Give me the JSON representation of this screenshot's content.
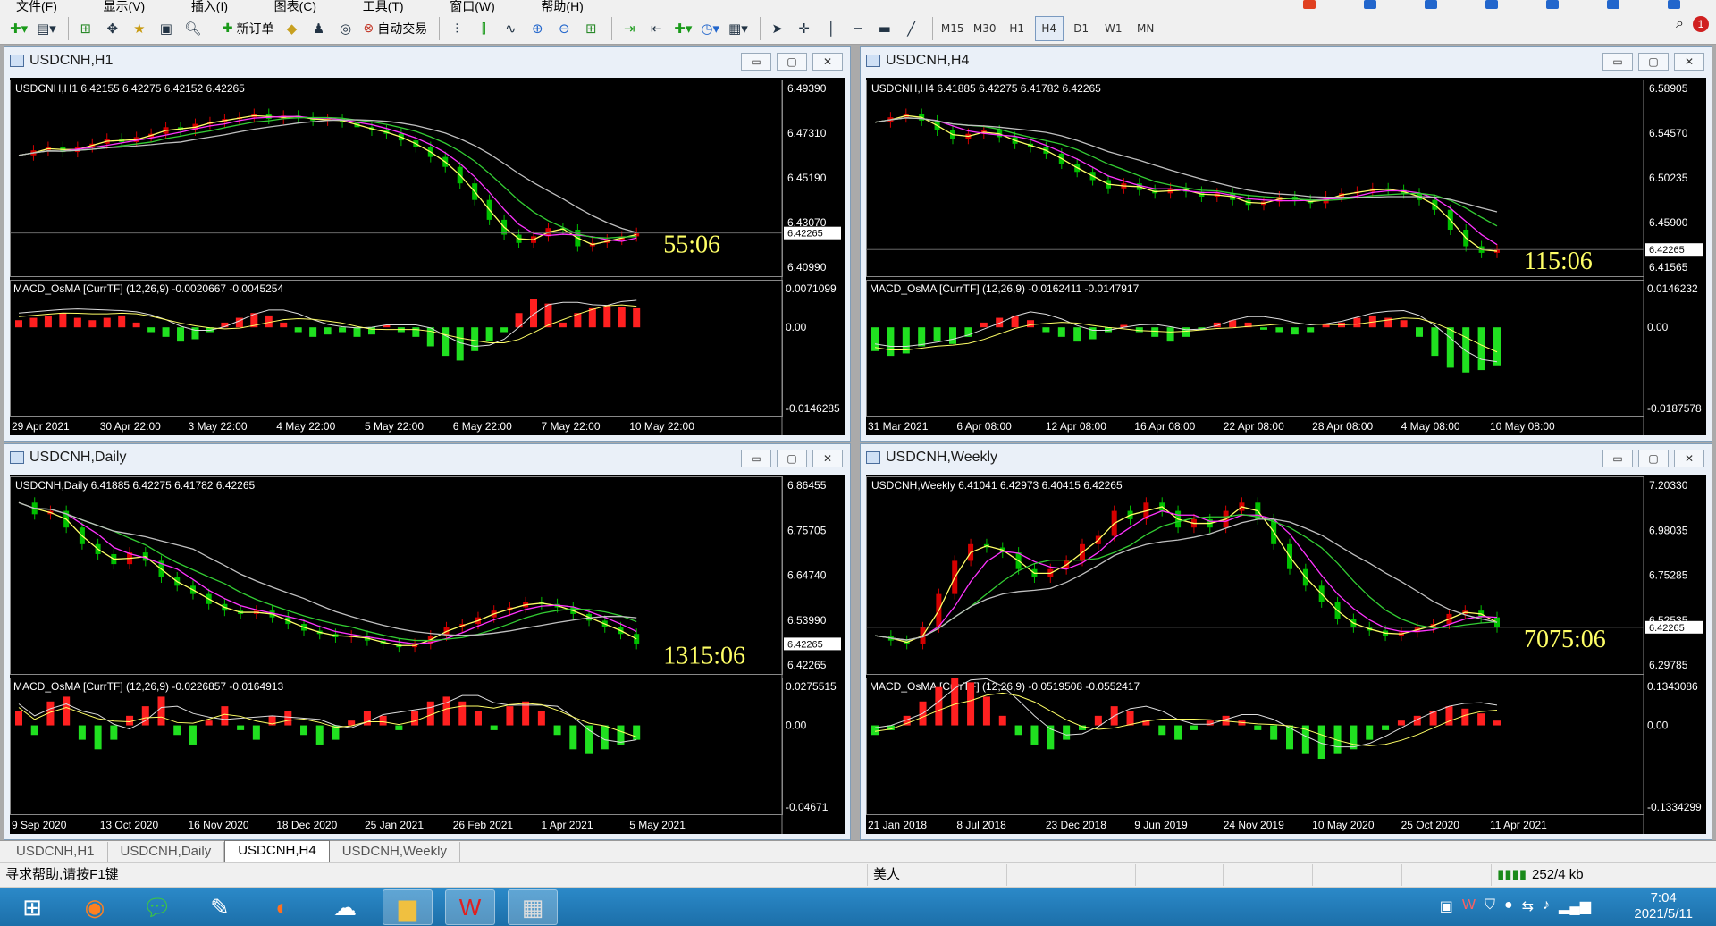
{
  "menu": [
    "文件(F)",
    "显示(V)",
    "插入(I)",
    "图表(C)",
    "工具(T)",
    "窗口(W)",
    "帮助(H)"
  ],
  "toolbar": {
    "new_order": "新订单",
    "auto_trade": "自动交易",
    "timeframes": [
      "M15",
      "M30",
      "H1",
      "H4",
      "D1",
      "W1",
      "MN"
    ],
    "active_timeframe": "H4"
  },
  "colors": {
    "up": "#d40000",
    "down": "#00c000",
    "ma_yellow": "#ffff66",
    "ma_magenta": "#ff33ff",
    "ma_green": "#33cc33",
    "ma_gray": "#c0c0c0",
    "countdown": "#ffff66",
    "hist_up": "#ff2020",
    "hist_down": "#20e020"
  },
  "windows": [
    {
      "title": "USDCNH,H1",
      "info": "USDCNH,H1  6.42155 6.42275 6.42152 6.42265",
      "price_labels": [
        "6.49390",
        "6.47310",
        "6.45190",
        "6.43070",
        "6.40990"
      ],
      "current_price": "6.42265",
      "countdown": "55:06",
      "macd_info": "MACD_OsMA [CurrTF] (12,26,9) -0.0020667 -0.0045254",
      "macd_labels": [
        "0.0071099",
        "0.00",
        "-0.0146285"
      ],
      "dates": [
        "29 Apr 2021",
        "30 Apr 22:00",
        "3 May 22:00",
        "4 May 22:00",
        "5 May 22:00",
        "6 May 22:00",
        "7 May 22:00",
        "10 May 22:00"
      ],
      "price_path": [
        0.35,
        0.32,
        0.3,
        0.33,
        0.3,
        0.28,
        0.25,
        0.27,
        0.24,
        0.22,
        0.18,
        0.2,
        0.16,
        0.15,
        0.13,
        0.12,
        0.1,
        0.13,
        0.11,
        0.12,
        0.14,
        0.13,
        0.15,
        0.18,
        0.2,
        0.22,
        0.26,
        0.3,
        0.36,
        0.42,
        0.52,
        0.62,
        0.74,
        0.83,
        0.88,
        0.84,
        0.79,
        0.8,
        0.9,
        0.88,
        0.86,
        0.84,
        0.82
      ],
      "hist": [
        0.15,
        0.2,
        0.25,
        0.3,
        0.2,
        0.15,
        0.2,
        0.25,
        0.1,
        -0.1,
        -0.2,
        -0.3,
        -0.25,
        -0.1,
        0.1,
        0.2,
        0.3,
        0.25,
        0.1,
        -0.1,
        -0.2,
        -0.15,
        -0.1,
        -0.2,
        -0.15,
        0.05,
        -0.1,
        -0.2,
        -0.4,
        -0.6,
        -0.7,
        -0.5,
        -0.3,
        -0.1,
        0.3,
        0.6,
        0.5,
        0.1,
        0.3,
        0.4,
        0.45,
        0.42,
        0.4
      ]
    },
    {
      "title": "USDCNH,H4",
      "info": "USDCNH,H4  6.41885 6.42275 6.41782 6.42265",
      "price_labels": [
        "6.58905",
        "6.54570",
        "6.50235",
        "6.45900",
        "6.41565"
      ],
      "current_price": "6.42265",
      "countdown": "115:06",
      "macd_info": "MACD_OsMA [CurrTF] (12,26,9) -0.0162411 -0.0147917",
      "macd_labels": [
        "0.0146232",
        "0.00",
        "-0.0187578"
      ],
      "dates": [
        "31 Mar 2021",
        "6 Apr 08:00",
        "12 Apr 08:00",
        "16 Apr 08:00",
        "22 Apr 08:00",
        "28 Apr 08:00",
        "4 May 08:00",
        "10 May 08:00"
      ],
      "price_path": [
        0.15,
        0.12,
        0.1,
        0.14,
        0.2,
        0.25,
        0.22,
        0.2,
        0.24,
        0.28,
        0.3,
        0.34,
        0.4,
        0.45,
        0.5,
        0.55,
        0.52,
        0.56,
        0.58,
        0.55,
        0.57,
        0.6,
        0.58,
        0.62,
        0.65,
        0.63,
        0.6,
        0.62,
        0.64,
        0.6,
        0.58,
        0.57,
        0.55,
        0.56,
        0.58,
        0.62,
        0.68,
        0.8,
        0.9,
        0.94,
        0.92
      ],
      "hist": [
        -0.5,
        -0.6,
        -0.55,
        -0.4,
        -0.3,
        -0.35,
        -0.2,
        0.1,
        0.2,
        0.25,
        0.15,
        -0.1,
        -0.2,
        -0.3,
        -0.25,
        -0.1,
        0.05,
        -0.1,
        -0.2,
        -0.3,
        -0.2,
        -0.05,
        0.1,
        0.15,
        0.1,
        -0.05,
        -0.1,
        -0.15,
        -0.1,
        0.05,
        0.1,
        0.2,
        0.25,
        0.2,
        0.15,
        -0.2,
        -0.6,
        -0.85,
        -0.95,
        -0.9,
        -0.8
      ]
    },
    {
      "title": "USDCNH,Daily",
      "info": "USDCNH,Daily  6.41885 6.42275 6.41782 6.42265",
      "price_labels": [
        "6.86455",
        "6.75705",
        "6.64740",
        "6.53990",
        "6.42265"
      ],
      "current_price": "6.42265",
      "countdown": "1315:06",
      "macd_info": "MACD_OsMA [CurrTF] (12,26,9) -0.0226857 -0.0164913",
      "macd_labels": [
        "0.0275515",
        "0.00",
        "-0.04671"
      ],
      "dates": [
        "9 Sep 2020",
        "13 Oct 2020",
        "16 Nov 2020",
        "18 Dec 2020",
        "25 Jan 2021",
        "26 Feb 2021",
        "1 Apr 2021",
        "5 May 2021"
      ],
      "price_path": [
        0.05,
        0.12,
        0.1,
        0.2,
        0.3,
        0.36,
        0.42,
        0.35,
        0.4,
        0.5,
        0.55,
        0.6,
        0.66,
        0.7,
        0.72,
        0.7,
        0.74,
        0.78,
        0.82,
        0.84,
        0.86,
        0.85,
        0.88,
        0.9,
        0.92,
        0.9,
        0.85,
        0.8,
        0.78,
        0.74,
        0.7,
        0.68,
        0.65,
        0.66,
        0.68,
        0.72,
        0.76,
        0.8,
        0.84,
        0.9
      ],
      "hist": [
        0.3,
        -0.2,
        0.5,
        0.6,
        -0.3,
        -0.5,
        -0.3,
        0.2,
        0.4,
        0.6,
        -0.2,
        -0.4,
        0.1,
        0.4,
        -0.1,
        -0.3,
        0.2,
        0.3,
        -0.2,
        -0.4,
        -0.3,
        0.1,
        0.3,
        0.2,
        -0.1,
        0.3,
        0.5,
        0.6,
        0.5,
        0.3,
        -0.1,
        0.4,
        0.5,
        0.3,
        -0.2,
        -0.5,
        -0.6,
        -0.5,
        -0.4,
        -0.3
      ]
    },
    {
      "title": "USDCNH,Weekly",
      "info": "USDCNH,Weekly  6.41041 6.42973 6.40415 6.42265",
      "price_labels": [
        "7.20330",
        "6.98035",
        "6.75285",
        "6.52535",
        "6.29785"
      ],
      "current_price": "6.42265",
      "countdown": "7075:06",
      "macd_info": "MACD_OsMA [CurrTF] (12,26,9) -0.0519508 -0.0552417",
      "macd_labels": [
        "0.1343086",
        "0.00",
        "-0.1334299"
      ],
      "dates": [
        "21 Jan 2018",
        "8 Jul 2018",
        "23 Dec 2018",
        "9 Jun 2019",
        "24 Nov 2019",
        "10 May 2020",
        "25 Oct 2020",
        "11 Apr 2021"
      ],
      "price_path": [
        0.85,
        0.88,
        0.9,
        0.8,
        0.6,
        0.4,
        0.3,
        0.32,
        0.35,
        0.45,
        0.5,
        0.45,
        0.4,
        0.3,
        0.25,
        0.1,
        0.15,
        0.05,
        0.1,
        0.2,
        0.15,
        0.2,
        0.1,
        0.05,
        0.15,
        0.3,
        0.45,
        0.55,
        0.65,
        0.75,
        0.8,
        0.82,
        0.85,
        0.83,
        0.8,
        0.78,
        0.72,
        0.7,
        0.74,
        0.8
      ],
      "hist": [
        -0.2,
        -0.1,
        0.2,
        0.5,
        0.8,
        1.0,
        0.9,
        0.6,
        0.2,
        -0.2,
        -0.4,
        -0.5,
        -0.3,
        -0.1,
        0.2,
        0.4,
        0.3,
        0.1,
        -0.2,
        -0.3,
        -0.1,
        0.1,
        0.2,
        0.1,
        -0.1,
        -0.3,
        -0.5,
        -0.6,
        -0.7,
        -0.6,
        -0.5,
        -0.3,
        -0.1,
        0.1,
        0.2,
        0.3,
        0.4,
        0.35,
        0.25,
        0.1
      ]
    }
  ],
  "tabs": [
    "USDCNH,H1",
    "USDCNH,Daily",
    "USDCNH,H4",
    "USDCNH,Weekly"
  ],
  "active_tab": "USDCNH,H4",
  "status": {
    "help": "寻求帮助,请按F1键",
    "profile": "美人",
    "traffic": "252/4 kb"
  },
  "clock": {
    "time": "7:04",
    "date": "2021/5/11"
  },
  "win_buttons": {
    "min": "▭",
    "max": "▢",
    "close": "✕"
  },
  "toolbar_icons": [
    "new-chart-icon",
    "profiles-icon",
    "market-watch-icon",
    "navigator-icon",
    "favorites-icon",
    "terminal-icon",
    "tester-icon"
  ]
}
